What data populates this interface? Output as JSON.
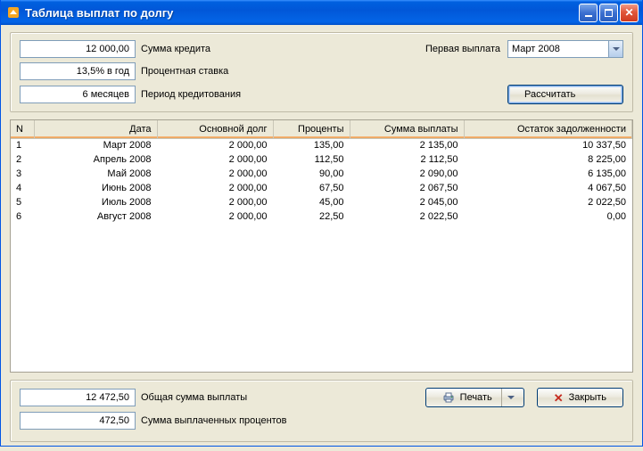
{
  "window": {
    "title": "Таблица выплат по долгу"
  },
  "inputs": {
    "loan_amount": "12 000,00",
    "loan_amount_label": "Сумма кредита",
    "rate": "13,5% в год",
    "rate_label": "Процентная ставка",
    "period": "6 месяцев",
    "period_label": "Период кредитования",
    "first_payment_label": "Первая выплата",
    "first_payment_value": "Март 2008",
    "calculate_btn": "Рассчитать"
  },
  "grid": {
    "headers": {
      "n": "N",
      "date": "Дата",
      "principal": "Основной долг",
      "interest": "Проценты",
      "payment": "Сумма выплаты",
      "balance": "Остаток задолженности"
    },
    "rows": [
      {
        "n": "1",
        "date": "Март 2008",
        "principal": "2 000,00",
        "interest": "135,00",
        "payment": "2 135,00",
        "balance": "10 337,50"
      },
      {
        "n": "2",
        "date": "Апрель 2008",
        "principal": "2 000,00",
        "interest": "112,50",
        "payment": "2 112,50",
        "balance": "8 225,00"
      },
      {
        "n": "3",
        "date": "Май 2008",
        "principal": "2 000,00",
        "interest": "90,00",
        "payment": "2 090,00",
        "balance": "6 135,00"
      },
      {
        "n": "4",
        "date": "Июнь 2008",
        "principal": "2 000,00",
        "interest": "67,50",
        "payment": "2 067,50",
        "balance": "4 067,50"
      },
      {
        "n": "5",
        "date": "Июль 2008",
        "principal": "2 000,00",
        "interest": "45,00",
        "payment": "2 045,00",
        "balance": "2 022,50"
      },
      {
        "n": "6",
        "date": "Август 2008",
        "principal": "2 000,00",
        "interest": "22,50",
        "payment": "2 022,50",
        "balance": "0,00"
      }
    ]
  },
  "totals": {
    "total_payment": "12 472,50",
    "total_payment_label": "Общая сумма выплаты",
    "total_interest": "472,50",
    "total_interest_label": "Сумма выплаченных процентов"
  },
  "buttons": {
    "print": "Печать",
    "close": "Закрыть"
  }
}
